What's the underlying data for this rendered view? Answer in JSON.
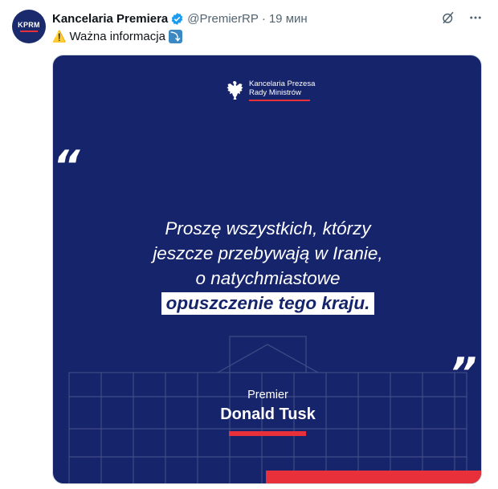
{
  "author": {
    "avatar_text": "KPRM",
    "name": "Kancelaria Premiera",
    "handle": "@PremierRP",
    "separator": "·",
    "time": "19 мин"
  },
  "tweet": {
    "text": "Ważna informacja",
    "warn_emoji": "⚠️",
    "arrow_glyph": "⤵"
  },
  "image": {
    "logo_line1": "Kancelaria Prezesa",
    "logo_line2": "Rady Ministrów",
    "quote_open": "“",
    "quote_close": "”",
    "message_line1": "Proszę wszystkich, którzy",
    "message_line2": "jeszcze przebywają w Iranie,",
    "message_line3": "o natychmiastowe",
    "message_highlight": "opuszczenie tego kraju.",
    "role": "Premier",
    "person": "Donald Tusk"
  },
  "colors": {
    "navy": "#16246b",
    "red": "#e8303a",
    "verified": "#1d9bf0"
  },
  "icons": [
    "grok-icon",
    "more-icon",
    "verified-icon",
    "eagle-emblem-icon"
  ]
}
